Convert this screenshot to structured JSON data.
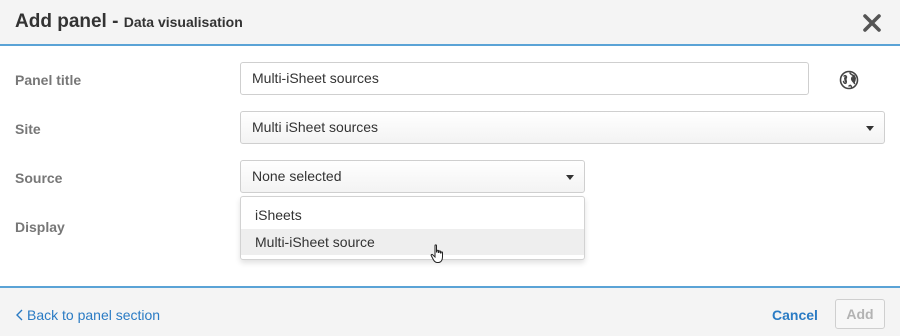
{
  "dialog": {
    "title": "Add panel",
    "separator": "-",
    "subtitle": "Data visualisation",
    "close_icon": "close-icon"
  },
  "form": {
    "panel_title": {
      "label": "Panel title",
      "value": "Multi-iSheet sources",
      "icon": "globe-icon"
    },
    "site": {
      "label": "Site",
      "value": "Multi iSheet sources"
    },
    "source": {
      "label": "Source",
      "value": "None selected"
    },
    "display": {
      "label": "Display"
    }
  },
  "source_dropdown": {
    "options": [
      "iSheets",
      "Multi-iSheet source"
    ],
    "hovered_index": 1
  },
  "footer": {
    "back_label": "Back to panel section",
    "cancel_label": "Cancel",
    "add_label": "Add"
  },
  "colors": {
    "accent": "#2a7bc4",
    "header_border": "#5aa3d6",
    "label": "#777777",
    "disabled_text": "#b3b3b3"
  }
}
